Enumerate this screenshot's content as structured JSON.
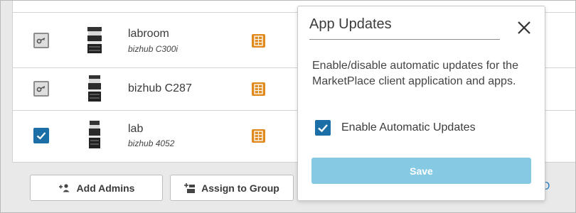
{
  "devices": [
    {
      "name": "labroom",
      "model": "bizhub C300i",
      "checkbox_state": "disabled"
    },
    {
      "name": "bizhub C287",
      "model": "",
      "checkbox_state": "disabled"
    },
    {
      "name": "lab",
      "model": "bizhub 4052",
      "checkbox_state": "checked"
    }
  ],
  "row_trailing_text": "-",
  "buttons": {
    "add_admins": "Add Admins",
    "assign_to_group": "Assign to Group"
  },
  "bottom_right_fragment": "O",
  "modal": {
    "title": "App Updates",
    "description": "Enable/disable automatic updates for the MarketPlace client application and apps.",
    "checkbox_label": "Enable Automatic Updates",
    "checkbox_checked": true,
    "save_label": "Save"
  },
  "colors": {
    "accent_blue": "#1c6fa6",
    "save_button_disabled": "#86c9e3",
    "app_icon_orange": "#e08a1e"
  },
  "icons": {
    "disabled_checkbox": "key-icon",
    "checked_checkbox": "check-icon",
    "device": "printer-icon",
    "app": "app-grid-icon",
    "add_admins": "add-user-icon",
    "assign_to_group": "add-to-group-icon",
    "close": "close-icon"
  }
}
